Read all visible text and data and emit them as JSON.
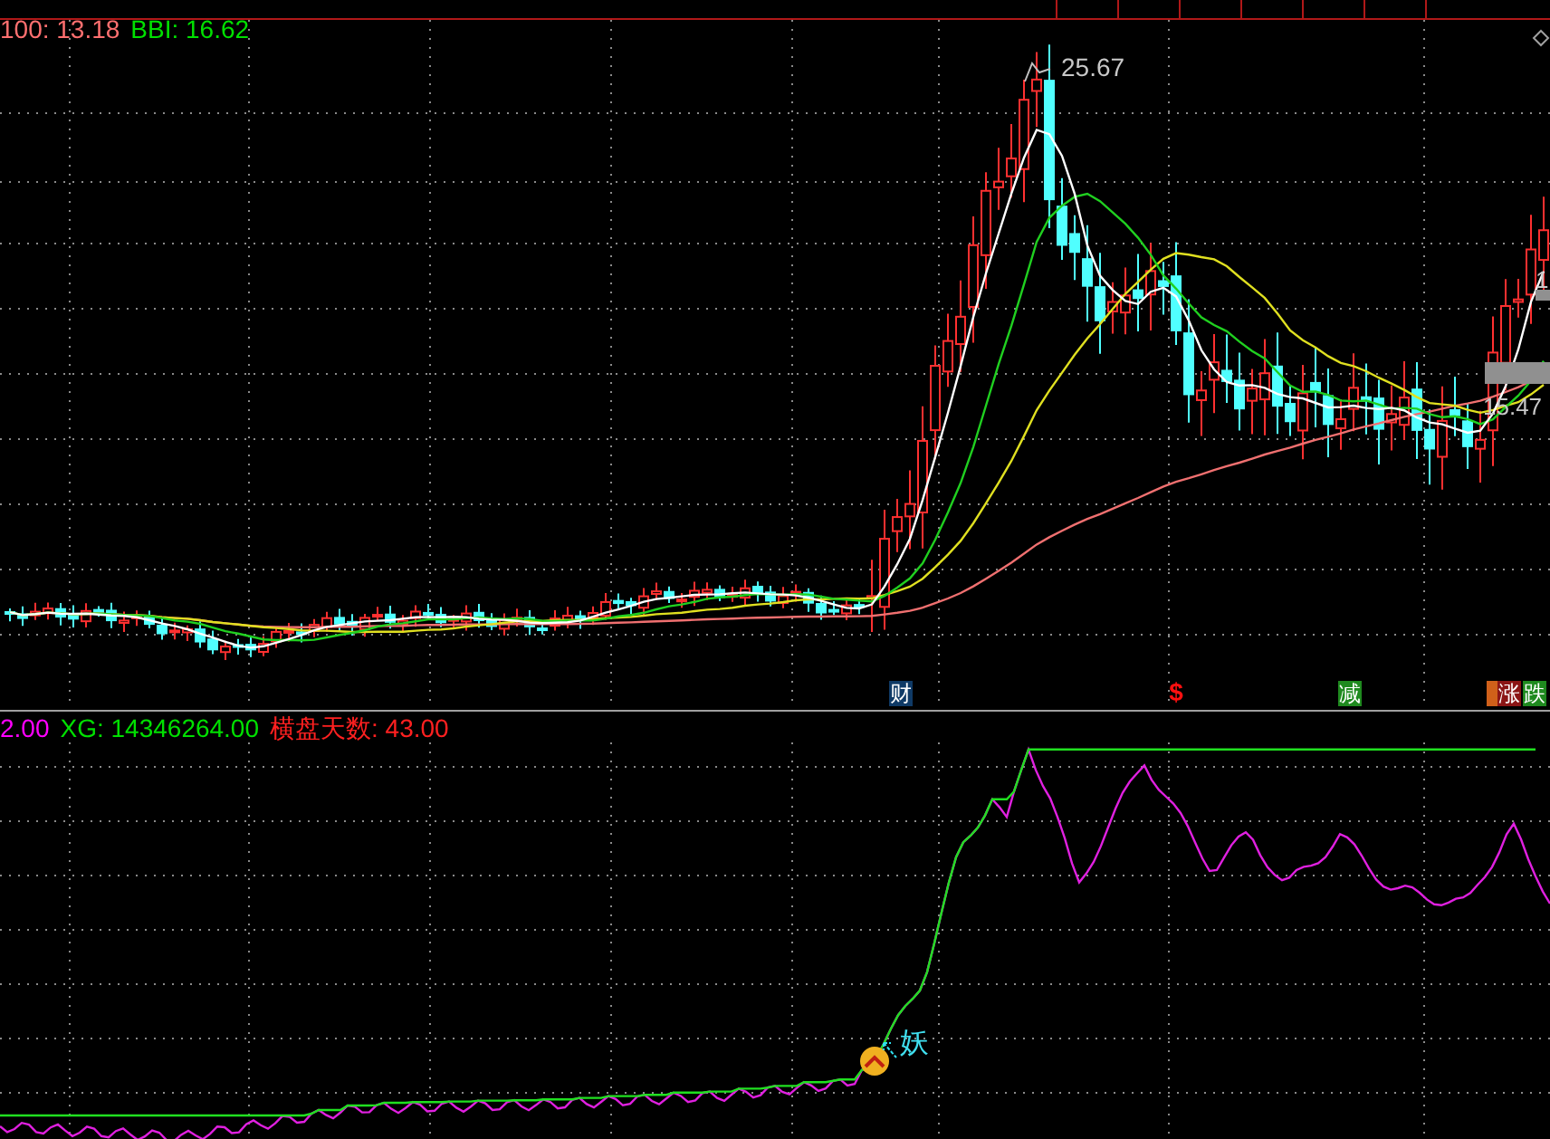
{
  "main_chart": {
    "legend": [
      {
        "text": "100: 13.18",
        "color": "#ff7070"
      },
      {
        "text": "BBI: 16.62",
        "color": "#00e000"
      }
    ],
    "price_labels": [
      {
        "text": "25.67"
      },
      {
        "text": "15.47"
      },
      {
        "text": "1"
      }
    ],
    "event_markers": [
      {
        "kind": "box",
        "text": "财",
        "color": "#0f3a66"
      },
      {
        "kind": "glyph",
        "text": "$",
        "color": "#ff1010"
      },
      {
        "kind": "box",
        "text": "减",
        "color": "#1f8a1f"
      },
      {
        "kind": "blank",
        "color": "#d0601a"
      },
      {
        "kind": "box",
        "text": "涨",
        "color": "#8b1515"
      },
      {
        "kind": "box",
        "text": "跌",
        "color": "#1f8a1f"
      }
    ]
  },
  "indicator": {
    "legend": [
      {
        "text": "2.00",
        "color": "#ff00ff"
      },
      {
        "text": "XG: 14346264.00",
        "color": "#00e000"
      },
      {
        "text": "横盘天数: 43.00",
        "color": "#ff2020"
      }
    ],
    "signal": {
      "text": "妖"
    }
  }
}
